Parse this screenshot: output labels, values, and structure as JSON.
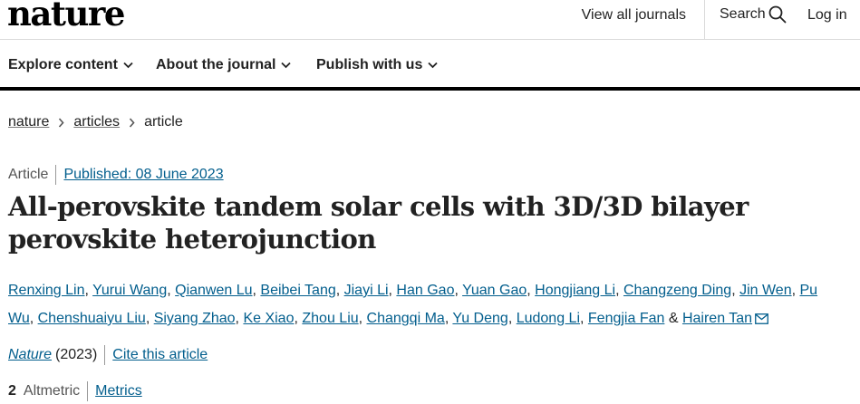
{
  "header": {
    "logo": "nature",
    "view_all_journals": "View all journals",
    "search_label": "Search",
    "login_label": "Log in"
  },
  "nav": {
    "items": [
      {
        "label": "Explore content"
      },
      {
        "label": "About the journal"
      },
      {
        "label": "Publish with us"
      }
    ]
  },
  "breadcrumb": {
    "items": [
      "nature",
      "articles"
    ],
    "current": "article"
  },
  "article": {
    "type": "Article",
    "published": "Published: 08 June 2023",
    "title": "All-perovskite tandem solar cells with 3D/3D bilayer perovskite heterojunction",
    "authors": [
      "Renxing Lin",
      "Yurui Wang",
      "Qianwen Lu",
      "Beibei Tang",
      "Jiayi Li",
      "Han Gao",
      "Yuan Gao",
      "Hongjiang Li",
      "Changzeng Ding",
      "Jin Wen",
      "Pu Wu",
      "Chenshuaiyu Liu",
      "Siyang Zhao",
      "Ke Xiao",
      "Zhou Liu",
      "Changqi Ma",
      "Yu Deng",
      "Ludong Li",
      "Fengjia Fan"
    ],
    "last_author_joiner": "&",
    "last_author": "Hairen Tan",
    "journal": "Nature",
    "year": "(2023)",
    "cite_label": "Cite this article",
    "altmetric_count": "2",
    "altmetric_label": "Altmetric",
    "metrics_label": "Metrics"
  },
  "colors": {
    "link": "#025e8d",
    "text": "#222222",
    "muted": "#555555"
  }
}
